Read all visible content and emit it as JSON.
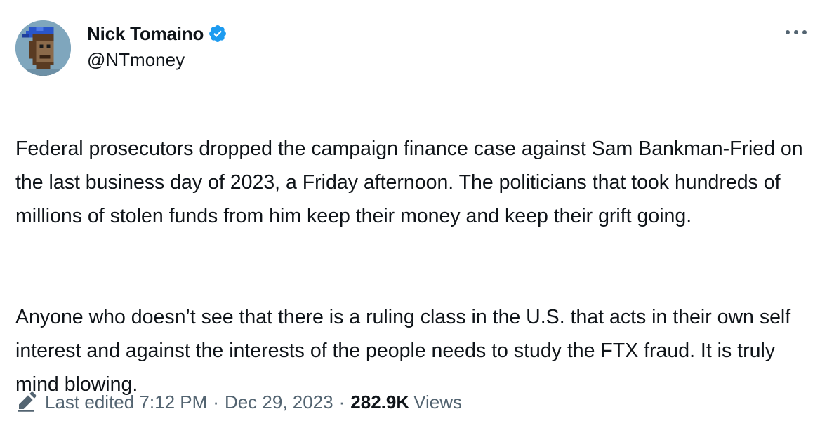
{
  "author": {
    "display_name": "Nick Tomaino",
    "handle": "@NTmoney",
    "verified": true,
    "avatar_icon": "pixel-ape-avatar-icon"
  },
  "tweet": {
    "paragraphs": [
      "Federal prosecutors dropped the campaign finance case against Sam Bankman-Fried on the last business day of 2023, a Friday afternoon. The politicians that took hundreds of millions of stolen funds from him keep their money and keep their grift going.",
      "Anyone who doesn’t see that there is a ruling class in the U.S. that acts in their own self interest and against the interests of the people needs to study the FTX fraud. It is truly mind blowing."
    ]
  },
  "meta": {
    "edit_icon": "pencil-icon",
    "edited_label": "Last edited 7:12 PM",
    "separator": "·",
    "date": "Dec 29, 2023",
    "views_count": "282.9K",
    "views_label": "Views"
  },
  "colors": {
    "text_primary": "#0f1419",
    "text_secondary": "#536471",
    "verified_badge": "#1d9bf0"
  }
}
